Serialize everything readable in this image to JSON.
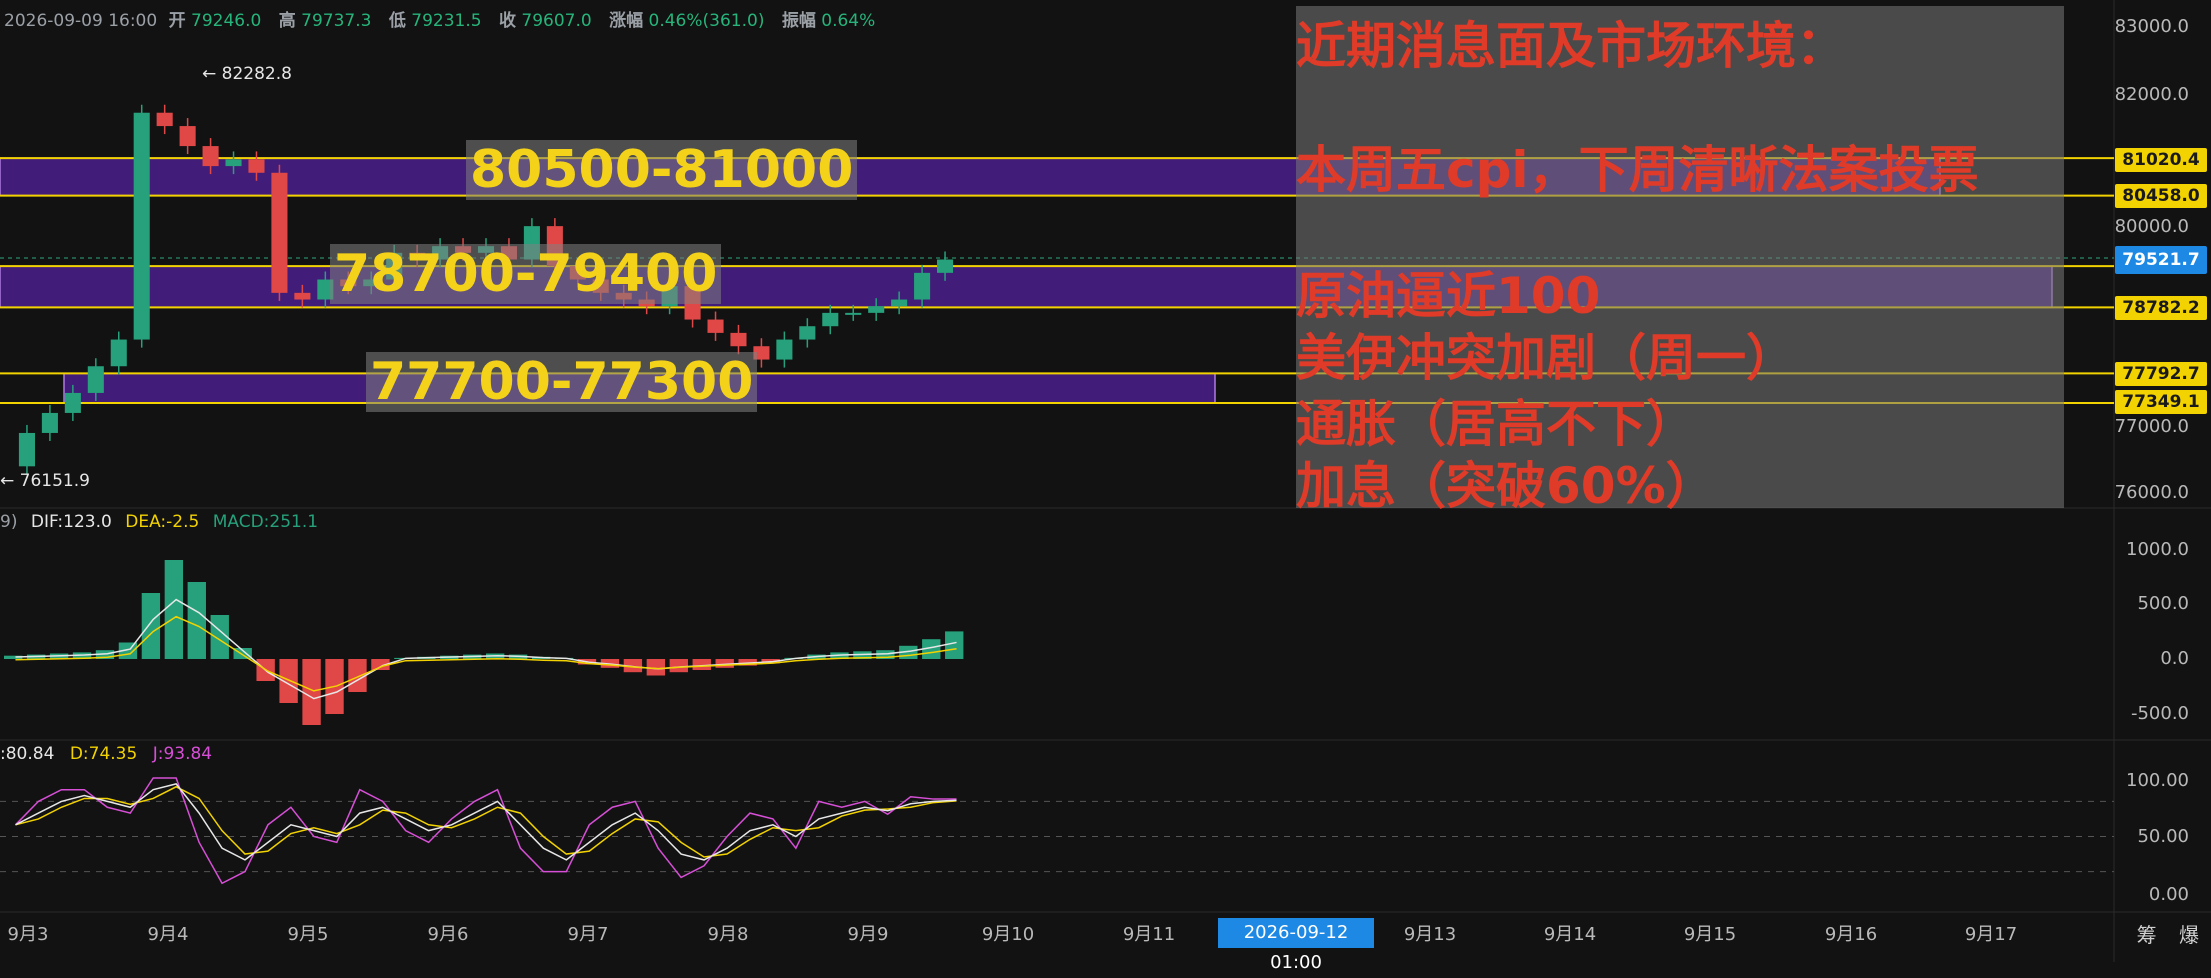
{
  "header": {
    "datetime": "2026-09-09 16:00",
    "open_label": "开",
    "open": "79246.0",
    "high_label": "高",
    "high": "79737.3",
    "low_label": "低",
    "low": "79231.5",
    "close_label": "收",
    "close": "79607.0",
    "change_label": "涨幅",
    "change": "0.46%(361.0)",
    "amp_label": "振幅",
    "amp": "0.64%"
  },
  "annotations": {
    "high": "← 82282.8",
    "low": "← 76151.9"
  },
  "zones": [
    {
      "label": "80500-81000",
      "top": 81020.4,
      "bottom": 80458.0
    },
    {
      "label": "78700-79400",
      "top": 79400,
      "bottom": 78782.2
    },
    {
      "label": "77700-77300",
      "top": 77792.7,
      "bottom": 77349.1
    }
  ],
  "news": {
    "title": "近期消息面及市场环境：",
    "items": [
      "本周五cpi，下周清晰法案投票",
      "原油逼近100",
      "美伊冲突加剧（周一）",
      "通胀（居高不下）",
      "加息（突破60%）"
    ]
  },
  "price_tags": {
    "zone1_top": "81020.4",
    "zone1_bottom": "80458.0",
    "current": "79521.7",
    "zone2_bottom": "78782.2",
    "zone3_top": "77792.7",
    "zone3_bottom": "77349.1"
  },
  "price_axis": [
    "83000.0",
    "82000.0",
    "81000.0",
    "80000.0",
    "79000.0",
    "78000.0",
    "77000.0",
    "76000.0"
  ],
  "macd": {
    "prefix": "9)",
    "dif": "DIF:123.0",
    "dea": "DEA:-2.5",
    "macd": "MACD:251.1",
    "axis": [
      "1000.0",
      "500.0",
      "0.0",
      "-500.0"
    ]
  },
  "kdj": {
    "k": ":80.84",
    "d": "D:74.35",
    "j": "J:93.84",
    "axis": [
      "100.00",
      "50.00",
      "0.00"
    ]
  },
  "dates": [
    "9月3",
    "9月4",
    "9月5",
    "9月6",
    "9月7",
    "9月8",
    "9月9",
    "9月10",
    "9月11",
    "9月13",
    "9月14",
    "9月15",
    "9月16",
    "9月17"
  ],
  "crosshair_date": "2026-09-12 01:00",
  "corner_text": "筹 爆",
  "colors": {
    "up": "#26a17b",
    "down": "#e04848",
    "zone": "#4a1f8c",
    "line": "#f2d200"
  },
  "chart_data": {
    "type": "candlestick",
    "title": "",
    "x": [
      "9月3",
      "9月4",
      "9月5",
      "9月6",
      "9月7",
      "9月8",
      "9月9"
    ],
    "ylim": [
      75700,
      83200
    ],
    "price_path": [
      76400,
      76900,
      77200,
      77500,
      77900,
      78300,
      81700,
      81500,
      81200,
      80900,
      81000,
      80800,
      79000,
      78900,
      79200,
      79100,
      79200,
      79600,
      79500,
      79700,
      79600,
      79700,
      79500,
      80000,
      79400,
      79200,
      79000,
      78900,
      78800,
      79100,
      78600,
      78400,
      78200,
      78000,
      78300,
      78500,
      78700,
      78700,
      78800,
      78900,
      79300,
      79500
    ],
    "macd_hist": [
      30,
      40,
      50,
      60,
      80,
      150,
      600,
      900,
      700,
      400,
      100,
      -200,
      -400,
      -600,
      -500,
      -300,
      -100,
      10,
      20,
      30,
      40,
      50,
      40,
      20,
      10,
      -50,
      -80,
      -120,
      -150,
      -120,
      -100,
      -80,
      -60,
      -40,
      10,
      40,
      60,
      70,
      80,
      120,
      180,
      251
    ],
    "kdj_k": [
      60,
      70,
      80,
      85,
      80,
      75,
      90,
      95,
      70,
      40,
      30,
      45,
      60,
      55,
      50,
      70,
      75,
      65,
      55,
      60,
      70,
      80,
      60,
      40,
      30,
      45,
      60,
      70,
      55,
      35,
      30,
      40,
      55,
      60,
      50,
      65,
      70,
      75,
      72,
      78,
      80,
      81
    ]
  }
}
